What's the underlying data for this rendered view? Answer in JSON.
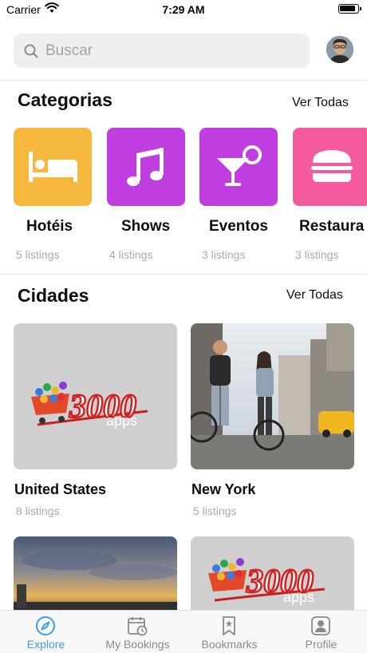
{
  "status_bar": {
    "carrier": "Carrier",
    "time": "7:29 AM"
  },
  "search": {
    "placeholder": "Buscar"
  },
  "categories": {
    "title": "Categorias",
    "see_all": "Ver Todas",
    "items": [
      {
        "name": "Hotéis",
        "count": "5 listings",
        "icon": "bed-icon",
        "color": "#f6b83d"
      },
      {
        "name": "Shows",
        "count": "4 listings",
        "icon": "music-note-icon",
        "color": "#c03ee0"
      },
      {
        "name": "Eventos",
        "count": "3 listings",
        "icon": "cocktail-icon",
        "color": "#c03ee0"
      },
      {
        "name": "Restaura",
        "count": "3 listings",
        "icon": "burger-icon",
        "color": "#f45a9c"
      }
    ]
  },
  "cities": {
    "title": "Cidades",
    "see_all": "Ver Todas",
    "items": [
      {
        "name": "United States",
        "count": "8 listings",
        "image": "3000-apps-logo"
      },
      {
        "name": "New York",
        "count": "5 listings",
        "image": "couple-with-bikes-photo"
      },
      {
        "name": "",
        "count": "",
        "image": "sunset-sky-photo"
      },
      {
        "name": "",
        "count": "",
        "image": "3000-apps-logo"
      }
    ]
  },
  "logo": {
    "number": "3000",
    "word": "apps"
  },
  "tabs": [
    {
      "label": "Explore",
      "icon": "compass-icon",
      "active": true
    },
    {
      "label": "My Bookings",
      "icon": "calendar-clock-icon",
      "active": false
    },
    {
      "label": "Bookmarks",
      "icon": "bookmark-icon",
      "active": false
    },
    {
      "label": "Profile",
      "icon": "profile-icon",
      "active": false
    }
  ],
  "colors": {
    "accent": "#3b9eea",
    "hotel": "#f6b83d",
    "shows": "#c03ee0",
    "events": "#c03ee0",
    "restaurants": "#f45a9c"
  }
}
